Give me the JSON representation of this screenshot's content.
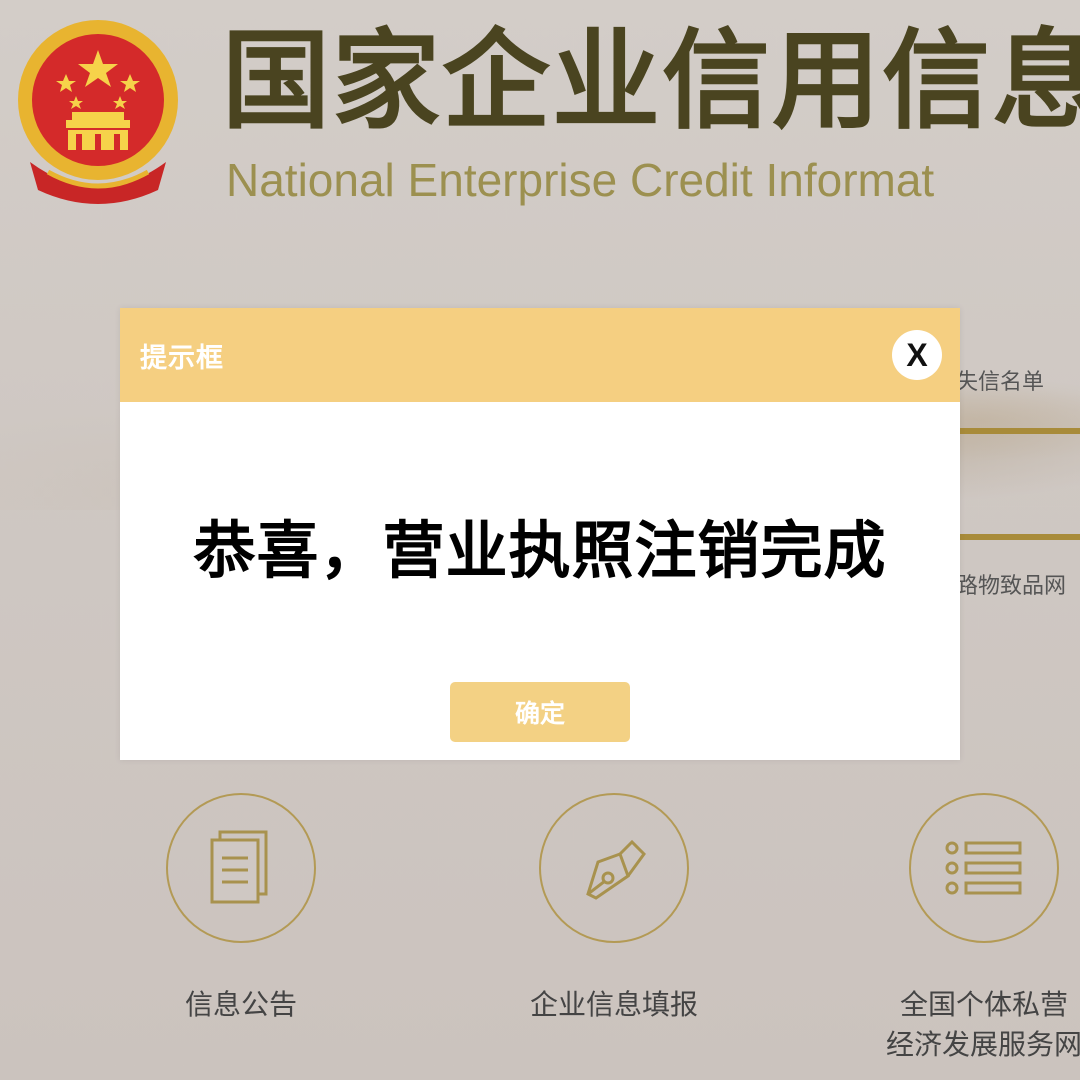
{
  "header": {
    "title_cn": "国家企业信用信息",
    "title_en": "National Enterprise Credit Informat"
  },
  "side_links": [
    {
      "label": "失信名单"
    },
    {
      "label": "路物致品网"
    }
  ],
  "dialog": {
    "title": "提示框",
    "close_label": "X",
    "message": "恭喜，营业执照注销完成",
    "ok_label": "确定"
  },
  "services": [
    {
      "label": "信息公告",
      "icon": "document-icon"
    },
    {
      "label": "企业信息填报",
      "icon": "pen-nib-icon"
    },
    {
      "label_line1": "全国个体私营",
      "label_line2": "经济发展服务网",
      "icon": "list-icon"
    }
  ],
  "colors": {
    "dialog_header": "#f5cf81",
    "ok_button": "#f3d184",
    "title_cn": "#4a4420",
    "title_en": "#9c9050",
    "emblem_red": "#d42a2a",
    "emblem_gold": "#e8b430"
  }
}
